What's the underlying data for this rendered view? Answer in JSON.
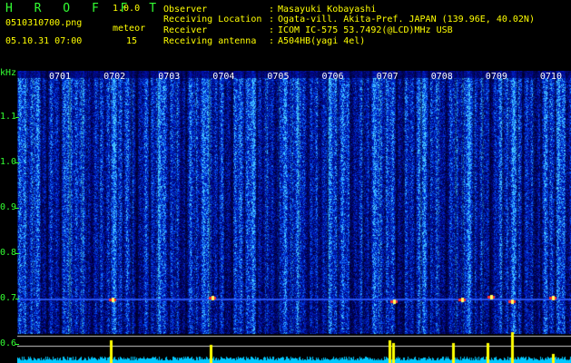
{
  "header": {
    "app_title": "H R O F F T",
    "version": "1.0.0",
    "filename": "0510310700.png",
    "mode": "meteor",
    "datetime": "05.10.31 07:00",
    "count": "15"
  },
  "info": [
    {
      "label": "Observer",
      "sep": ":",
      "value": "Masayuki Kobayashi"
    },
    {
      "label": "Receiving Location",
      "sep": ":",
      "value": "Ogata-vill. Akita-Pref. JAPAN (139.96E, 40.02N)"
    },
    {
      "label": "Receiver",
      "sep": ":",
      "value": "ICOM IC-575 53.7492(@LCD)MHz USB"
    },
    {
      "label": "Receiving antenna",
      "sep": ":",
      "value": "A504HB(yagi 4el)"
    }
  ],
  "axis": {
    "y_unit": "kHz",
    "y_ticks": [
      "1.1",
      "1.0",
      "0.9",
      "0.8",
      "0.7",
      "0.6"
    ],
    "x_ticks": [
      "0701",
      "0702",
      "0703",
      "0704",
      "0705",
      "0706",
      "0707",
      "0708",
      "0709",
      "0710"
    ]
  },
  "colors": {
    "background": "#000000",
    "header_green": "#33ff33",
    "header_yellow": "#ffff00",
    "spectrum_base": "#081a6e",
    "spectrum_hot": "#2f7cff",
    "level_trace": "#00c8ff",
    "meteor_spike": "#ffff00"
  },
  "detections": {
    "meteor_minutes": [
      "0702",
      "0704",
      "0707",
      "0709",
      "0710"
    ]
  }
}
